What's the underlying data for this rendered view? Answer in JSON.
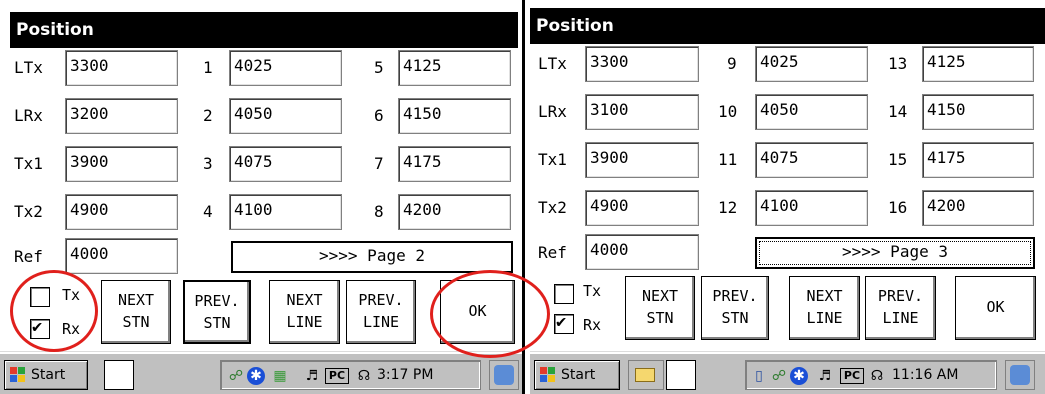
{
  "left": {
    "title": "Position",
    "rows": [
      {
        "label": "LTx",
        "value": "3300",
        "n1": "1",
        "v1": "4025",
        "n2": "5",
        "v2": "4125"
      },
      {
        "label": "LRx",
        "value": "3200",
        "n1": "2",
        "v1": "4050",
        "n2": "6",
        "v2": "4150"
      },
      {
        "label": "Tx1",
        "value": "3900",
        "n1": "3",
        "v1": "4075",
        "n2": "7",
        "v2": "4175"
      },
      {
        "label": "Tx2",
        "value": "4900",
        "n1": "4",
        "v1": "4100",
        "n2": "8",
        "v2": "4200"
      }
    ],
    "ref_label": "Ref",
    "ref_value": "4000",
    "page_button": ">>>> Page 2",
    "tx_label": "Tx",
    "rx_label": "Rx",
    "tx_checked": false,
    "rx_checked": true,
    "buttons": {
      "next_stn": [
        "NEXT",
        "STN"
      ],
      "prev_stn": [
        "PREV.",
        "STN"
      ],
      "next_line": [
        "NEXT",
        "LINE"
      ],
      "prev_line": [
        "PREV.",
        "LINE"
      ],
      "ok": "OK"
    },
    "taskbar": {
      "start": "Start",
      "clock": "3:17 PM"
    }
  },
  "right": {
    "title": "Position",
    "rows": [
      {
        "label": "LTx",
        "value": "3300",
        "n1": "9",
        "v1": "4025",
        "n2": "13",
        "v2": "4125"
      },
      {
        "label": "LRx",
        "value": "3100",
        "n1": "10",
        "v1": "4050",
        "n2": "14",
        "v2": "4150"
      },
      {
        "label": "Tx1",
        "value": "3900",
        "n1": "11",
        "v1": "4075",
        "n2": "15",
        "v2": "4175"
      },
      {
        "label": "Tx2",
        "value": "4900",
        "n1": "12",
        "v1": "4100",
        "n2": "16",
        "v2": "4200"
      }
    ],
    "ref_label": "Ref",
    "ref_value": "4000",
    "page_button": ">>>> Page 3",
    "tx_label": "Tx",
    "rx_label": "Rx",
    "tx_checked": false,
    "rx_checked": true,
    "buttons": {
      "next_stn": [
        "NEXT",
        "STN"
      ],
      "prev_stn": [
        "PREV.",
        "STN"
      ],
      "next_line": [
        "NEXT",
        "LINE"
      ],
      "prev_line": [
        "PREV.",
        "LINE"
      ],
      "ok": "OK"
    },
    "taskbar": {
      "start": "Start",
      "clock": "11:16 AM"
    }
  },
  "tray_icons": [
    "network-icon",
    "bluetooth-icon",
    "battery-icon",
    "sound-icon",
    "pc-sync-icon",
    "keyboard-icon"
  ],
  "colors": {
    "title_bg": "#000000",
    "taskbar_bg": "#c0c0c0",
    "annotation": "#e0201c",
    "bluetooth": "#1a4fd6"
  }
}
